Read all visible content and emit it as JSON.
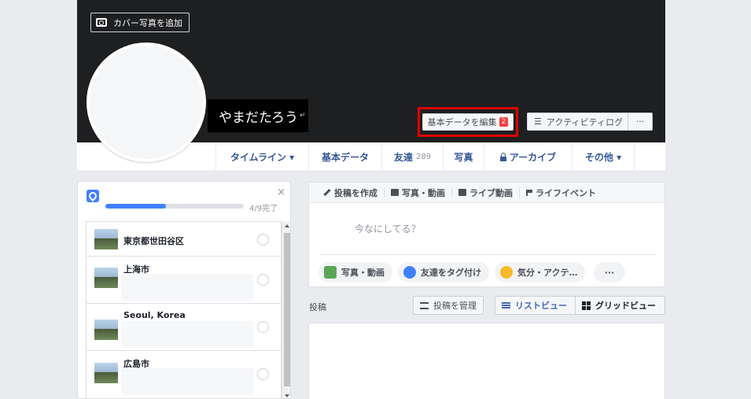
{
  "cover": {
    "add_cover_label": "カバー写真を追加",
    "profile_name": "やまだたろう",
    "return_mark": "↵",
    "edit_profile_label": "基本データを編集",
    "edit_badge": "2",
    "activity_log_label": "アクティビティログ",
    "more_label": "···"
  },
  "nav": {
    "tabs": [
      {
        "label": "タイムライン ▾"
      },
      {
        "label": "基本データ"
      },
      {
        "label": "友達",
        "count": "289"
      },
      {
        "label": "写真"
      },
      {
        "label": "アーカイブ"
      },
      {
        "label": "その他 ▾"
      }
    ]
  },
  "places": {
    "close": "×",
    "progress_fraction": 0.44,
    "progress_text": "4/9完了",
    "items": [
      {
        "label": "東京都世田谷区"
      },
      {
        "label": "上海市"
      },
      {
        "label": "Seoul, Korea"
      },
      {
        "label": "広島市"
      }
    ]
  },
  "composer": {
    "tabs": [
      "投稿を作成",
      "写真・動画",
      "ライブ動画",
      "ライフイベント"
    ],
    "placeholder": "今なにしてる？",
    "actions": [
      "写真・動画",
      "友達をタグ付け",
      "気分・アクテ…",
      "···"
    ]
  },
  "posts": {
    "section_label": "投稿",
    "manage_label": "投稿を管理",
    "list_view_label": "リストビュー",
    "grid_view_label": "グリッドビュー"
  },
  "colors": {
    "accent": "#4267b2",
    "link": "#365899",
    "highlight_border": "#e00000",
    "badge": "#fa3e3e"
  },
  "icons": {
    "add_cover": "camera-icon",
    "location": "location-pin-icon",
    "composer_write": "pencil-icon",
    "composer_photo": "camera-icon",
    "composer_live": "video-icon",
    "composer_event": "flag-icon",
    "archive": "lock-icon"
  }
}
